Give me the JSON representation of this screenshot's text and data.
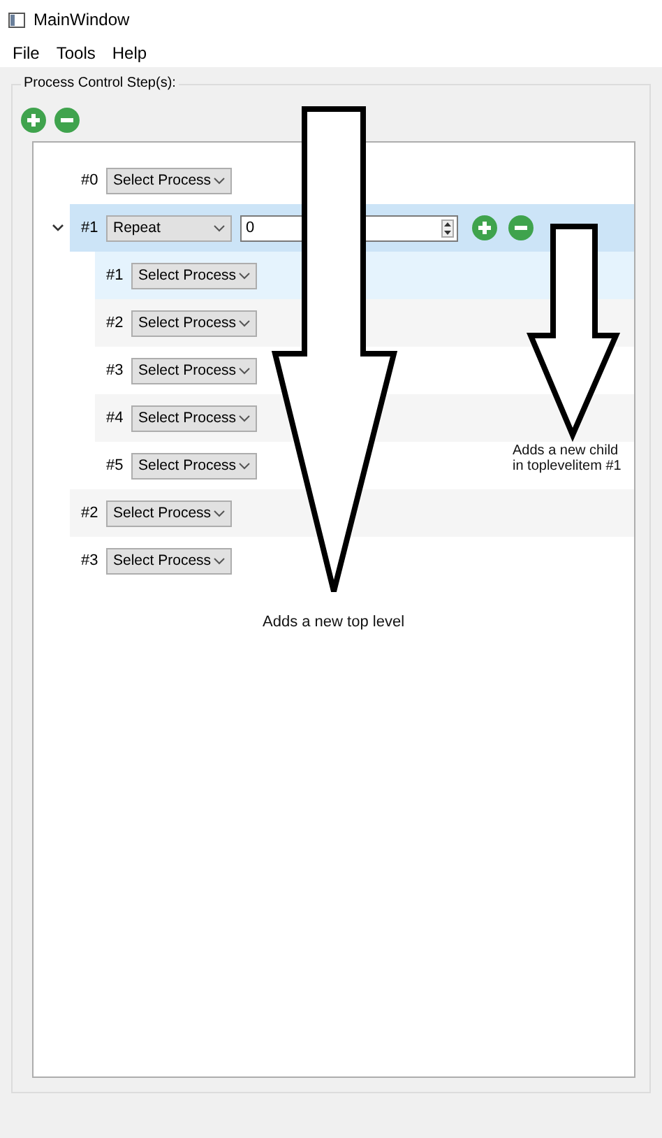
{
  "window": {
    "title": "MainWindow"
  },
  "menu": [
    "File",
    "Tools",
    "Help"
  ],
  "group": {
    "title": "Process Control Step(s):"
  },
  "toolbar": [
    {
      "kind": "add"
    },
    {
      "kind": "remove"
    }
  ],
  "tree": [
    {
      "label": "#0",
      "process": "Select Process",
      "selected": false,
      "highlighted": false
    },
    {
      "label": "#1",
      "process": "Repeat",
      "selected": true,
      "highlighted": false,
      "expanded": true,
      "repeat_count": "0",
      "item_buttons": [
        {
          "kind": "add"
        },
        {
          "kind": "remove"
        }
      ],
      "children": [
        {
          "label": "#1",
          "process": "Select Process",
          "selected": false,
          "highlighted": true
        },
        {
          "label": "#2",
          "process": "Select Process",
          "selected": false,
          "highlighted": false
        },
        {
          "label": "#3",
          "process": "Select Process",
          "selected": false,
          "highlighted": false
        },
        {
          "label": "#4",
          "process": "Select Process",
          "selected": false,
          "highlighted": false
        },
        {
          "label": "#5",
          "process": "Select Process",
          "selected": false,
          "highlighted": false
        }
      ]
    },
    {
      "label": "#2",
      "process": "Select Process",
      "selected": false,
      "highlighted": false
    },
    {
      "label": "#3",
      "process": "Select Process",
      "selected": false,
      "highlighted": false
    }
  ],
  "annotations": [
    {
      "kind": "top-level",
      "text": "Adds a new top level"
    },
    {
      "kind": "child",
      "text": "Adds a new child in toplevelitem #1"
    }
  ]
}
